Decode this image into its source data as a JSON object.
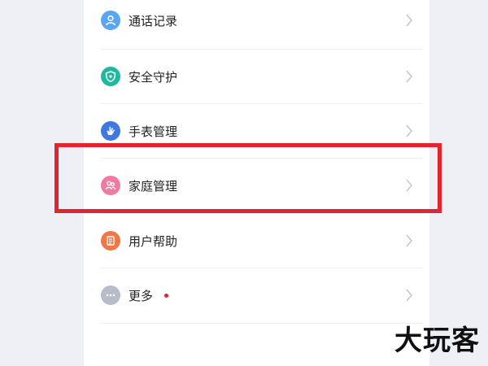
{
  "menu": {
    "items": [
      {
        "label": "通话记录",
        "icon": "call-record-icon",
        "color": "#5aa6f2"
      },
      {
        "label": "安全守护",
        "icon": "shield-icon",
        "color": "#20b8a0"
      },
      {
        "label": "手表管理",
        "icon": "hand-icon",
        "color": "#3f78e0"
      },
      {
        "label": "家庭管理",
        "icon": "family-icon",
        "color": "#f07aa0"
      },
      {
        "label": "用户帮助",
        "icon": "help-book-icon",
        "color": "#f07845"
      },
      {
        "label": "更多",
        "icon": "more-icon",
        "color": "#b5bcca",
        "badge_color": "#e2242c"
      }
    ],
    "chevron_icon": "chevron-right-icon"
  },
  "highlight": {
    "target": "家庭管理",
    "color": "#e2242c"
  },
  "watermark": {
    "text": "大玩客"
  }
}
